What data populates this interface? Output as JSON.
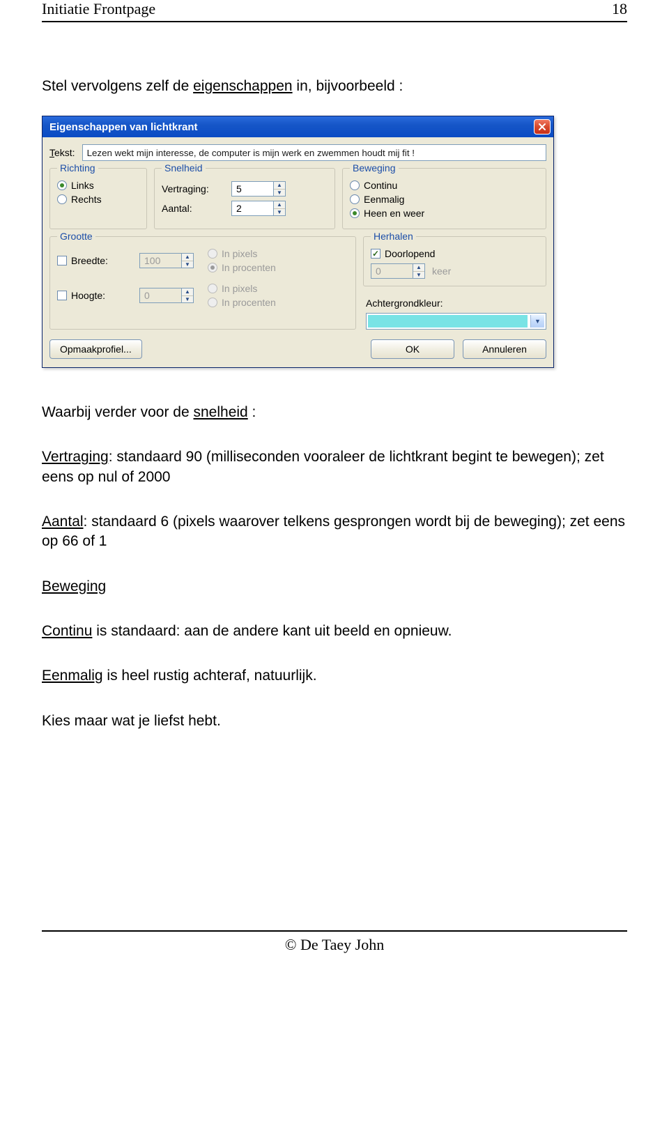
{
  "header": {
    "title": "Initiatie Frontpage",
    "page_number": "18"
  },
  "intro": {
    "prefix": "Stel vervolgens zelf de ",
    "underlined": "eigenschappen",
    "suffix": " in, bijvoorbeeld :"
  },
  "dialog": {
    "title": "Eigenschappen van lichtkrant",
    "close_aria": "Close",
    "tekst": {
      "label_html": "Tekst:",
      "label_ul": "T",
      "value": "Lezen wekt mijn interesse, de computer is mijn werk en zwemmen houdt mij fit !"
    },
    "richting": {
      "legend": "Richting",
      "links": {
        "label": "Links",
        "ul": "L",
        "checked": true
      },
      "rechts": {
        "label": "Rechts",
        "ul": "R",
        "checked": false
      }
    },
    "snelheid": {
      "legend": "Snelheid",
      "vertraging": {
        "label": "Vertraging:",
        "ul": "V",
        "value": "5"
      },
      "aantal": {
        "label": "Aantal:",
        "ul": "A",
        "value": "2"
      }
    },
    "beweging": {
      "legend": "Beweging",
      "continu": {
        "label": "Continu",
        "ul": "u",
        "checked": false
      },
      "eenmalig": {
        "label": "Eenmalig",
        "ul": "E",
        "checked": false
      },
      "heen_weer": {
        "label": "Heen en weer",
        "ul": "w",
        "checked": true
      }
    },
    "grootte": {
      "legend": "Grootte",
      "breedte": {
        "label": "Breedte:",
        "ul": "B",
        "enabled": false,
        "value": "100"
      },
      "hoogte": {
        "label": "Hoogte:",
        "ul": "H",
        "enabled": false,
        "value": "0"
      },
      "unit_pixels": {
        "label": "In pixels",
        "ul": "p"
      },
      "unit_procenten": {
        "label": "In procenten",
        "ul": null
      }
    },
    "herhalen": {
      "legend": "Herhalen",
      "doorlopend": {
        "label": "Doorlopend",
        "ul": "D",
        "checked": true
      },
      "keer_value": "0",
      "keer_label": "keer"
    },
    "achtergrond": {
      "label": "Achtergrondkleur:",
      "ul": "k",
      "color": "#79e3e5"
    },
    "footer": {
      "opmaakprofiel": "Opmaakprofiel...",
      "opmaak_ul": "f",
      "ok": "OK",
      "annuleren": "Annuleren"
    }
  },
  "body": {
    "p1_prefix": "Waarbij verder voor de ",
    "p1_underlined": "snelheid",
    "p1_suffix": " :",
    "p2": "Vertraging: standaard 90 (milliseconden vooraleer de lichtkrant begint te bewegen); zet eens op nul of 2000",
    "p2_ul": "Vertraging",
    "p2_rest": ": standaard 90 (milliseconden vooraleer de lichtkrant begint te bewegen); zet eens op nul of 2000",
    "p3_ul": "Aantal",
    "p3_rest": ": standaard 6 (pixels waarover telkens gesprongen wordt bij de beweging); zet eens op 66 of 1",
    "p4_ul": "Beweging",
    "p5_ul": "Continu",
    "p5_rest": " is standaard: aan de andere kant uit beeld en opnieuw.",
    "p6_ul": "Eenmalig",
    "p6_rest": " is heel rustig achteraf, natuurlijk.",
    "p7": "Kies maar wat je liefst hebt."
  },
  "footer": {
    "copyright": "© De Taey John"
  }
}
